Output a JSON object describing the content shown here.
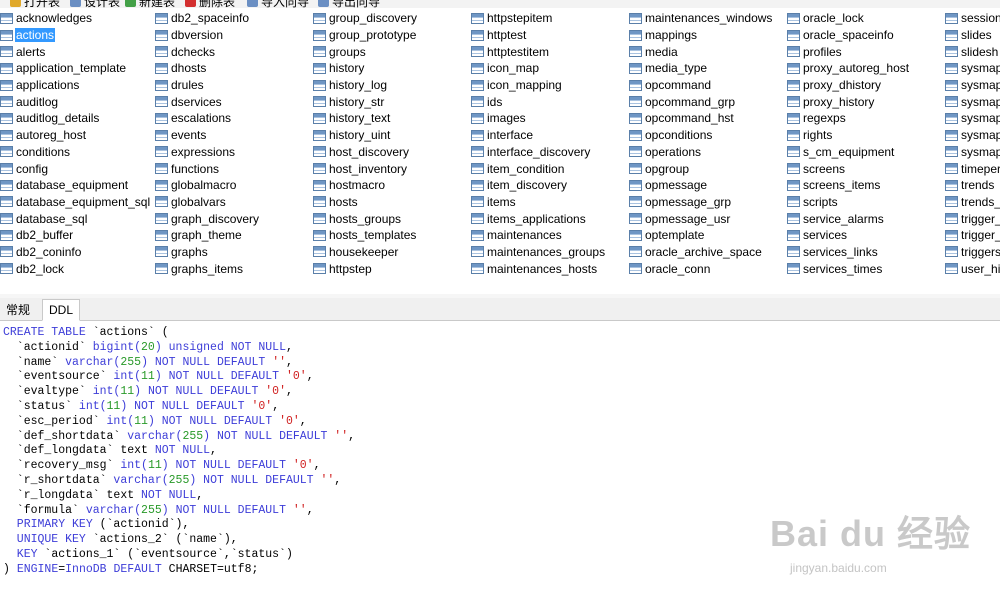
{
  "toolbar": {
    "items": [
      {
        "label": "打开表",
        "color": "#e0a92c"
      },
      {
        "label": "设计表",
        "color": "#6b8fc3"
      },
      {
        "label": "新建表",
        "color": "#43a047"
      },
      {
        "label": "删除表",
        "color": "#d32f2f"
      },
      {
        "label": "导入向导",
        "color": "#6b8fc3"
      },
      {
        "label": "导出向导",
        "color": "#6b8fc3"
      }
    ]
  },
  "tables": {
    "selected": "actions",
    "columns": [
      [
        "acknowledges",
        "actions",
        "alerts",
        "application_template",
        "applications",
        "auditlog",
        "auditlog_details",
        "autoreg_host",
        "conditions",
        "config",
        "database_equipment",
        "database_equipment_sql",
        "database_sql",
        "db2_buffer",
        "db2_coninfo",
        "db2_lock"
      ],
      [
        "db2_spaceinfo",
        "dbversion",
        "dchecks",
        "dhosts",
        "drules",
        "dservices",
        "escalations",
        "events",
        "expressions",
        "functions",
        "globalmacro",
        "globalvars",
        "graph_discovery",
        "graph_theme",
        "graphs",
        "graphs_items"
      ],
      [
        "group_discovery",
        "group_prototype",
        "groups",
        "history",
        "history_log",
        "history_str",
        "history_text",
        "history_uint",
        "host_discovery",
        "host_inventory",
        "hostmacro",
        "hosts",
        "hosts_groups",
        "hosts_templates",
        "housekeeper",
        "httpstep"
      ],
      [
        "httpstepitem",
        "httptest",
        "httptestitem",
        "icon_map",
        "icon_mapping",
        "ids",
        "images",
        "interface",
        "interface_discovery",
        "item_condition",
        "item_discovery",
        "items",
        "items_applications",
        "maintenances",
        "maintenances_groups",
        "maintenances_hosts"
      ],
      [
        "maintenances_windows",
        "mappings",
        "media",
        "media_type",
        "opcommand",
        "opcommand_grp",
        "opcommand_hst",
        "opconditions",
        "operations",
        "opgroup",
        "opmessage",
        "opmessage_grp",
        "opmessage_usr",
        "optemplate",
        "oracle_archive_space",
        "oracle_conn"
      ],
      [
        "oracle_lock",
        "oracle_spaceinfo",
        "profiles",
        "proxy_autoreg_host",
        "proxy_dhistory",
        "proxy_history",
        "regexps",
        "rights",
        "s_cm_equipment",
        "screens",
        "screens_items",
        "scripts",
        "service_alarms",
        "services",
        "services_links",
        "services_times"
      ],
      [
        "session",
        "slides",
        "slidesh",
        "sysmap",
        "sysmap",
        "sysmap",
        "sysmap",
        "sysmap",
        "sysmap",
        "timeper",
        "trends",
        "trends_",
        "trigger_",
        "trigger_",
        "triggers",
        "user_his"
      ]
    ]
  },
  "tabs": [
    {
      "label": "常规",
      "active": false
    },
    {
      "label": "DDL",
      "active": true
    }
  ],
  "ddl": {
    "lines": [
      [
        [
          "kw",
          "CREATE TABLE "
        ],
        [
          "t",
          "`actions` ("
        ]
      ],
      [
        [
          "t",
          "  `actionid` "
        ],
        [
          "kw",
          "bigint("
        ],
        [
          "num",
          "20"
        ],
        [
          "kw",
          ") unsigned NOT NULL"
        ],
        [
          "t",
          ","
        ]
      ],
      [
        [
          "t",
          "  `name` "
        ],
        [
          "kw",
          "varchar("
        ],
        [
          "num",
          "255"
        ],
        [
          "kw",
          ") NOT NULL DEFAULT "
        ],
        [
          "str",
          "''"
        ],
        [
          "t",
          ","
        ]
      ],
      [
        [
          "t",
          "  `eventsource` "
        ],
        [
          "kw",
          "int("
        ],
        [
          "num",
          "11"
        ],
        [
          "kw",
          ") NOT NULL DEFAULT "
        ],
        [
          "str",
          "'0'"
        ],
        [
          "t",
          ","
        ]
      ],
      [
        [
          "t",
          "  `evaltype` "
        ],
        [
          "kw",
          "int("
        ],
        [
          "num",
          "11"
        ],
        [
          "kw",
          ") NOT NULL DEFAULT "
        ],
        [
          "str",
          "'0'"
        ],
        [
          "t",
          ","
        ]
      ],
      [
        [
          "t",
          "  `status` "
        ],
        [
          "kw",
          "int("
        ],
        [
          "num",
          "11"
        ],
        [
          "kw",
          ") NOT NULL DEFAULT "
        ],
        [
          "str",
          "'0'"
        ],
        [
          "t",
          ","
        ]
      ],
      [
        [
          "t",
          "  `esc_period` "
        ],
        [
          "kw",
          "int("
        ],
        [
          "num",
          "11"
        ],
        [
          "kw",
          ") NOT NULL DEFAULT "
        ],
        [
          "str",
          "'0'"
        ],
        [
          "t",
          ","
        ]
      ],
      [
        [
          "t",
          "  `def_shortdata` "
        ],
        [
          "kw",
          "varchar("
        ],
        [
          "num",
          "255"
        ],
        [
          "kw",
          ") NOT NULL DEFAULT "
        ],
        [
          "str",
          "''"
        ],
        [
          "t",
          ","
        ]
      ],
      [
        [
          "t",
          "  `def_longdata` text "
        ],
        [
          "kw",
          "NOT NULL"
        ],
        [
          "t",
          ","
        ]
      ],
      [
        [
          "t",
          "  `recovery_msg` "
        ],
        [
          "kw",
          "int("
        ],
        [
          "num",
          "11"
        ],
        [
          "kw",
          ") NOT NULL DEFAULT "
        ],
        [
          "str",
          "'0'"
        ],
        [
          "t",
          ","
        ]
      ],
      [
        [
          "t",
          "  `r_shortdata` "
        ],
        [
          "kw",
          "varchar("
        ],
        [
          "num",
          "255"
        ],
        [
          "kw",
          ") NOT NULL DEFAULT "
        ],
        [
          "str",
          "''"
        ],
        [
          "t",
          ","
        ]
      ],
      [
        [
          "t",
          "  `r_longdata` text "
        ],
        [
          "kw",
          "NOT NULL"
        ],
        [
          "t",
          ","
        ]
      ],
      [
        [
          "t",
          "  `formula` "
        ],
        [
          "kw",
          "varchar("
        ],
        [
          "num",
          "255"
        ],
        [
          "kw",
          ") NOT NULL DEFAULT "
        ],
        [
          "str",
          "''"
        ],
        [
          "t",
          ","
        ]
      ],
      [
        [
          "kw",
          "  PRIMARY KEY "
        ],
        [
          "t",
          "(`actionid`),"
        ]
      ],
      [
        [
          "kw",
          "  UNIQUE KEY "
        ],
        [
          "t",
          "`actions_2` (`name`),"
        ]
      ],
      [
        [
          "kw",
          "  KEY "
        ],
        [
          "t",
          "`actions_1` (`eventsource`,`status`)"
        ]
      ],
      [
        [
          "t",
          ") "
        ],
        [
          "kw",
          "ENGINE"
        ],
        [
          "t",
          "="
        ],
        [
          "kw",
          "InnoDB DEFAULT "
        ],
        [
          "t",
          "CHARSET=utf8;"
        ]
      ]
    ]
  },
  "watermark": {
    "brand": "Bai du 经验",
    "url": "jingyan.baidu.com"
  }
}
